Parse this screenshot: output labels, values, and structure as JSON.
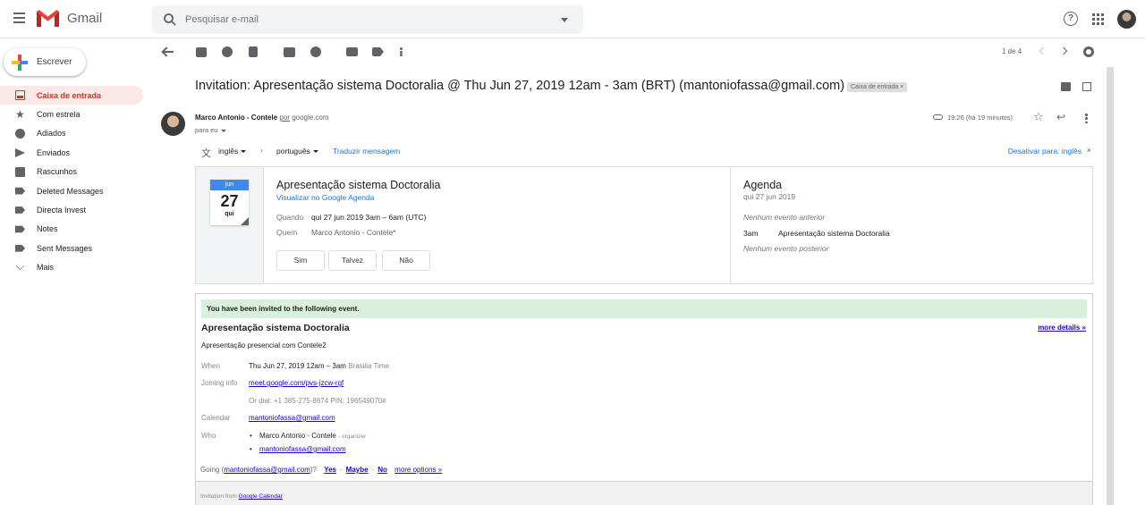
{
  "app": {
    "name": "Gmail"
  },
  "search": {
    "placeholder": "Pesquisar e-mail"
  },
  "compose": {
    "label": "Escrever"
  },
  "sidebar": {
    "items": [
      {
        "label": "Caixa de entrada",
        "icon": "inbox-icon",
        "active": true
      },
      {
        "label": "Com estrela",
        "icon": "star-icon"
      },
      {
        "label": "Adiados",
        "icon": "clock-icon"
      },
      {
        "label": "Enviados",
        "icon": "send-icon"
      },
      {
        "label": "Rascunhos",
        "icon": "draft-icon"
      },
      {
        "label": "Deleted Messages",
        "icon": "label-icon"
      },
      {
        "label": "Directa Invest",
        "icon": "label-icon"
      },
      {
        "label": "Notes",
        "icon": "label-icon"
      },
      {
        "label": "Sent Messages",
        "icon": "label-icon"
      },
      {
        "label": "Mais",
        "icon": "chevron-down-icon"
      }
    ]
  },
  "toolbar": {
    "pager": "1 de 4"
  },
  "message": {
    "subject": "Invitation: Apresentação sistema Doctoralia @ Thu Jun 27, 2019 12am - 3am (BRT) (mantoniofassa@gmail.com)",
    "label_chip": "Caixa de entrada ×",
    "sender_name": "Marco Antonio - Contele",
    "sender_via_prefix": "por",
    "sender_via_domain": "google.com",
    "to": "para eu",
    "time": "19:26 (há 19 minutos)"
  },
  "translate": {
    "from": "inglês",
    "to": "português",
    "translate_link": "Traduzir mensagem",
    "turn_off": "Desativar para: inglês",
    "close": "×"
  },
  "invite_card": {
    "month": "jun",
    "day": "27",
    "weekday": "qui",
    "title": "Apresentação sistema Doctoralia",
    "view_link": "Visualizar no Google Agenda",
    "when_label": "Quando",
    "when_value": "qui 27 jun 2019 3am – 6am (UTC)",
    "who_label": "Quem",
    "who_value": "Marco Antonio - Contele*",
    "rsvp_yes": "Sim",
    "rsvp_maybe": "Talvez",
    "rsvp_no": "Não"
  },
  "agenda": {
    "title": "Agenda",
    "date": "qui 27 jun 2019",
    "none_before": "Nenhum evento anterior",
    "event_time": "3am",
    "event_title": "Apresentação sistema Doctoralia",
    "none_after": "Nenhum evento posterior"
  },
  "email_body": {
    "banner": "You have been invited to the following event.",
    "title": "Apresentação sistema Doctoralia",
    "more_details": "more details »",
    "description": "Apresentação presencial com Contele2",
    "when_label": "When",
    "when_value": "Thu Jun 27, 2019 12am – 3am",
    "when_tz": "Brasilia Time",
    "joining_label": "Joining info",
    "joining_link": "meet.google.com/pvs-jzcw-rgf",
    "dial": "Or dial: +1 385-275-8674  PIN: 196549070#",
    "calendar_label": "Calendar",
    "calendar_value": "mantoniofassa@gmail.com",
    "who_label": "Who",
    "who_1_name": "Marco Antonio - Contele",
    "who_1_role": "- organizer",
    "who_2": "mantoniofassa@gmail.com",
    "going_prefix": "Going (",
    "going_email": "mantoniofassa@gmail.com",
    "going_suffix": ")?",
    "yes": "Yes",
    "maybe": "Maybe",
    "no": "No",
    "more_options": "more options »",
    "dash": "-",
    "footer_prefix": "Invitation from",
    "footer_link": "Google Calendar"
  },
  "colors": {
    "accent_red": "#d93025",
    "active_bg": "#fce8e6",
    "link_blue": "#1a73e8",
    "banner_green": "#d9f0dd"
  }
}
